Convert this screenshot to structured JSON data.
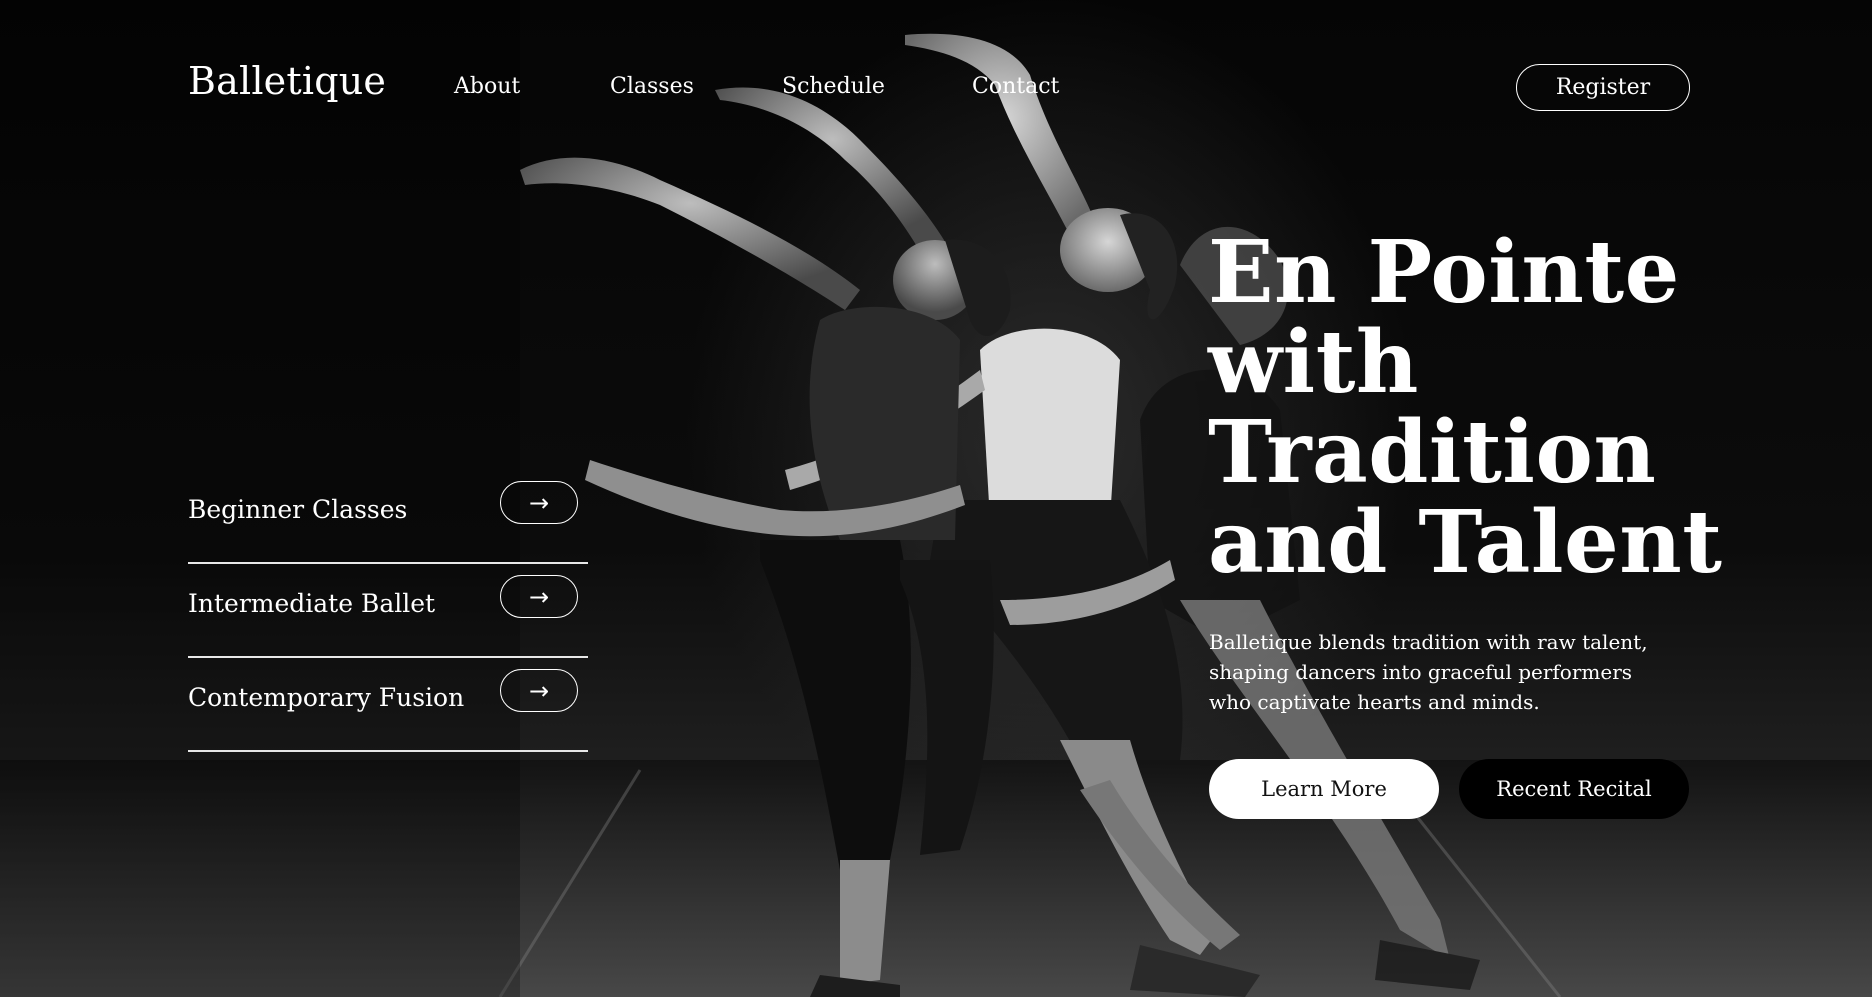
{
  "brand": {
    "name": "Balletique"
  },
  "nav": {
    "links": [
      "About",
      "Classes",
      "Schedule",
      "Contact"
    ],
    "register_label": "Register"
  },
  "classes": [
    {
      "label": "Beginner Classes",
      "arrow": "→"
    },
    {
      "label": "Intermediate Ballet",
      "arrow": "→"
    },
    {
      "label": "Contemporary Fusion",
      "arrow": "→"
    }
  ],
  "hero": {
    "headline_lines": [
      "En Pointe",
      "with",
      "Tradition",
      "and Talent"
    ],
    "description": "Balletique blends tradition with raw talent, shaping dancers into graceful performers who captivate hearts and minds.",
    "primary_cta": "Learn More",
    "secondary_cta": "Recent Recital"
  },
  "icons": {
    "class_arrow": "arrow-right-icon"
  }
}
